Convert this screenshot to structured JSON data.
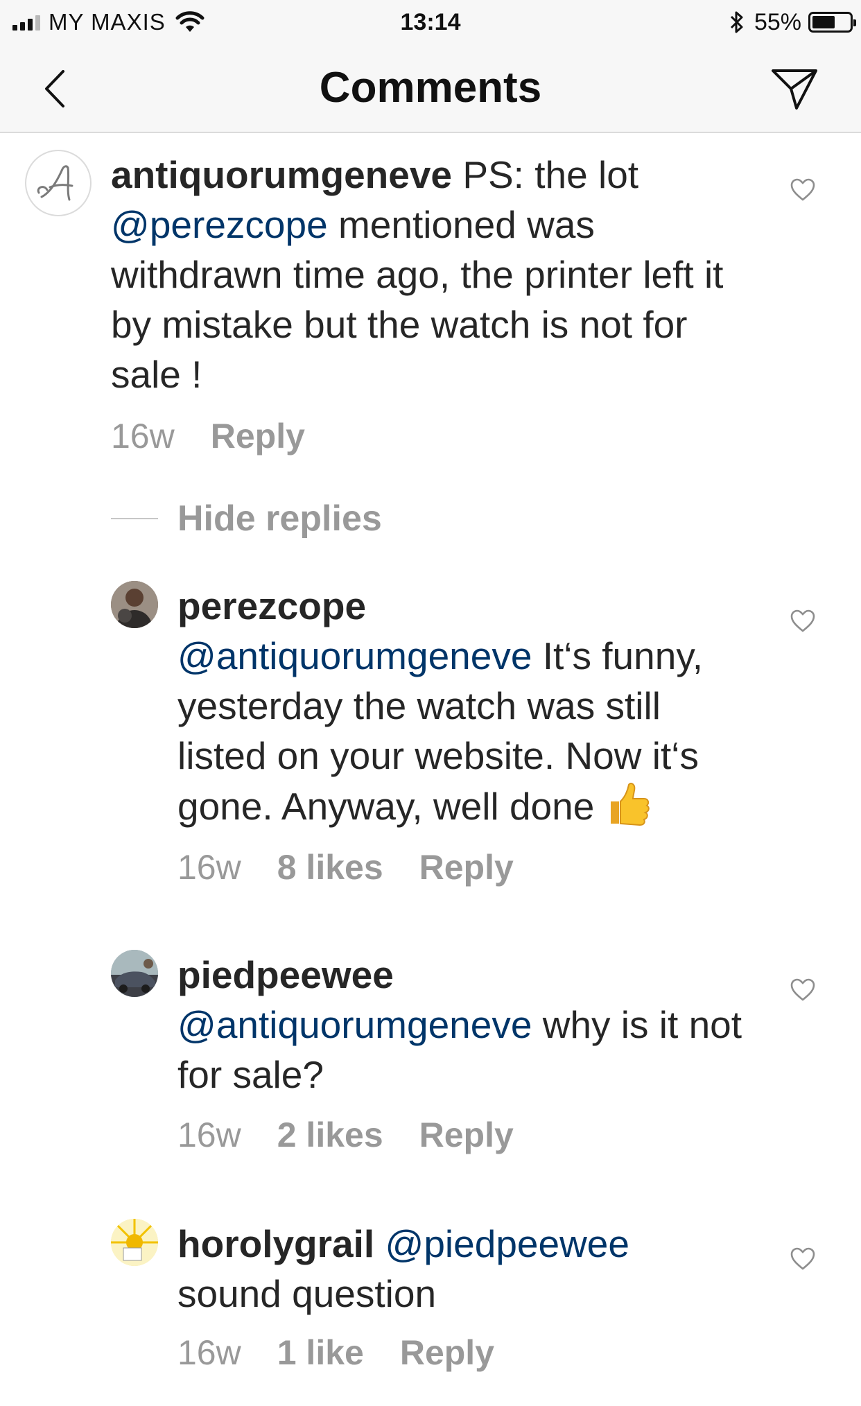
{
  "status_bar": {
    "carrier": "MY MAXIS",
    "time": "13:14",
    "battery_percent": "55%",
    "battery_level": 0.55,
    "icons": [
      "signal-icon",
      "wifi-icon",
      "bluetooth-icon",
      "battery-icon"
    ]
  },
  "nav": {
    "title": "Comments",
    "back_icon": "chevron-left-icon",
    "share_icon": "send-icon"
  },
  "comments": [
    {
      "username": "antiquorumgeneve",
      "text_before": "PS: the lot",
      "mention": "@perezcope",
      "text_after": "mentioned was withdrawn time ago, the printer left it by mistake but the watch is not for sale !",
      "time": "16w",
      "likes": "",
      "reply": "Reply"
    },
    {
      "username": "perezcope",
      "mention": "@antiquorumgeneve",
      "text_after": "It‘s funny, yesterday the watch was still listed on your website. Now it‘s gone. Anyway, well done",
      "emoji": "thumbs-up-emoji",
      "time": "16w",
      "likes": "8 likes",
      "reply": "Reply"
    },
    {
      "username": "piedpeewee",
      "mention": "@antiquorumgeneve",
      "text_after": "why is it not for sale?",
      "time": "16w",
      "likes": "2 likes",
      "reply": "Reply"
    },
    {
      "username": "horolygrail",
      "mention": "@piedpeewee",
      "text_after": "sound question",
      "time": "16w",
      "likes": "1 like",
      "reply": "Reply"
    }
  ],
  "hide_replies_label": "Hide replies"
}
